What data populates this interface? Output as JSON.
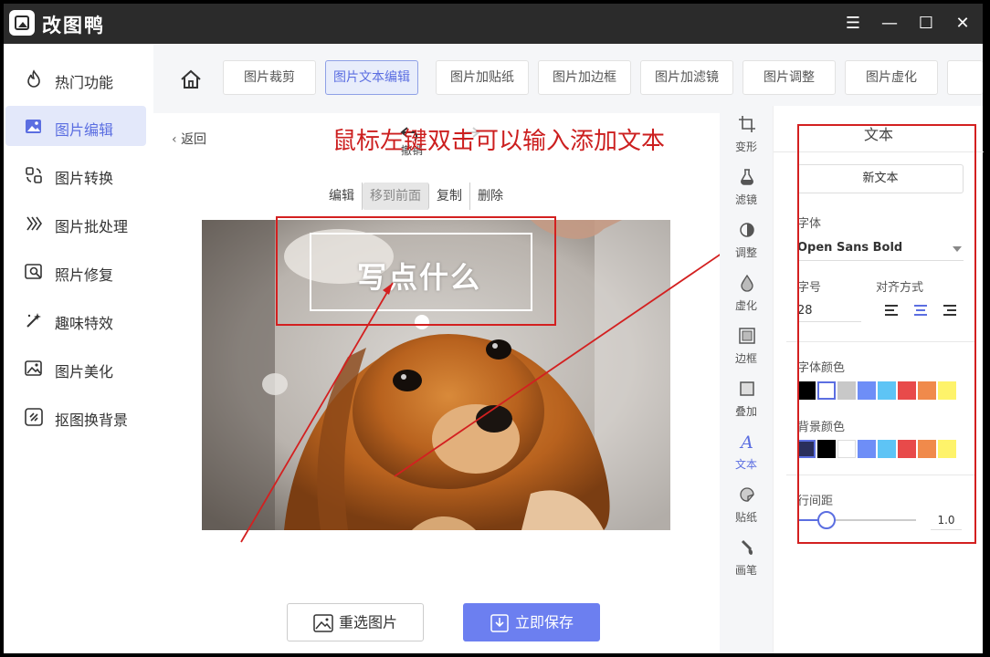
{
  "app": {
    "title": "改图鸭"
  },
  "window_controls": {
    "menu": "☰",
    "minimize": "—",
    "maximize": "☐",
    "close": "✕"
  },
  "sidebar": {
    "items": [
      {
        "label": "热门功能",
        "icon": "fire-icon",
        "active": false
      },
      {
        "label": "图片编辑",
        "icon": "image-edit-icon",
        "active": true
      },
      {
        "label": "图片转换",
        "icon": "convert-icon",
        "active": false
      },
      {
        "label": "图片批处理",
        "icon": "batch-icon",
        "active": false
      },
      {
        "label": "照片修复",
        "icon": "photo-repair-icon",
        "active": false
      },
      {
        "label": "趣味特效",
        "icon": "magic-wand-icon",
        "active": false
      },
      {
        "label": "图片美化",
        "icon": "beautify-icon",
        "active": false
      },
      {
        "label": "抠图换背景",
        "icon": "cutout-icon",
        "active": false
      }
    ]
  },
  "toolbar": {
    "tools": [
      "图片裁剪",
      "图片文本编辑",
      "图片加贴纸",
      "图片加边框",
      "图片加滤镜",
      "图片调整",
      "图片虚化"
    ],
    "active_tool": "图片文本编辑"
  },
  "canvas": {
    "back_label": "返回",
    "undo_label": "撤销",
    "annotation": "鼠标左键双击可以输入添加文本",
    "context_menu": [
      "编辑",
      "移到前面",
      "复制",
      "删除"
    ],
    "highlighted_context_item": "移到前面",
    "overlay_text": "写点什么",
    "reselect_label": "重选图片",
    "save_label": "立即保存"
  },
  "rail": {
    "items": [
      {
        "label": "变形",
        "icon": "crop-icon"
      },
      {
        "label": "滤镜",
        "icon": "filter-icon"
      },
      {
        "label": "调整",
        "icon": "adjust-icon"
      },
      {
        "label": "虚化",
        "icon": "blur-drop-icon"
      },
      {
        "label": "边框",
        "icon": "border-icon"
      },
      {
        "label": "叠加",
        "icon": "overlay-icon"
      },
      {
        "label": "文本",
        "icon": "text-icon",
        "active": true
      },
      {
        "label": "贴纸",
        "icon": "sticker-icon"
      },
      {
        "label": "画笔",
        "icon": "brush-icon"
      }
    ]
  },
  "panel": {
    "title": "文本",
    "new_text_label": "新文本",
    "font_label": "字体",
    "font_value": "Open Sans Bold",
    "size_label": "字号",
    "size_value": "28",
    "align_label": "对齐方式",
    "align_active": "center",
    "font_color_label": "字体颜色",
    "font_colors": [
      "#000000",
      "#ffffff",
      "#c8c8c8",
      "#6e8ef7",
      "#5ec4f5",
      "#e84a4a",
      "#f08a4b",
      "#fef36a"
    ],
    "bg_color_label": "背景颜色",
    "bg_colors": [
      "#2a2f5c",
      "#000000",
      "#ffffff",
      "#6e8ef7",
      "#5ec4f5",
      "#e84a4a",
      "#f08a4b",
      "#fef36a"
    ],
    "line_spacing_label": "行间距",
    "line_spacing_value": "1.0"
  },
  "colors": {
    "accent": "#5b6ee1",
    "annotation_red": "#d32020",
    "titlebar": "#2b2b2b"
  }
}
